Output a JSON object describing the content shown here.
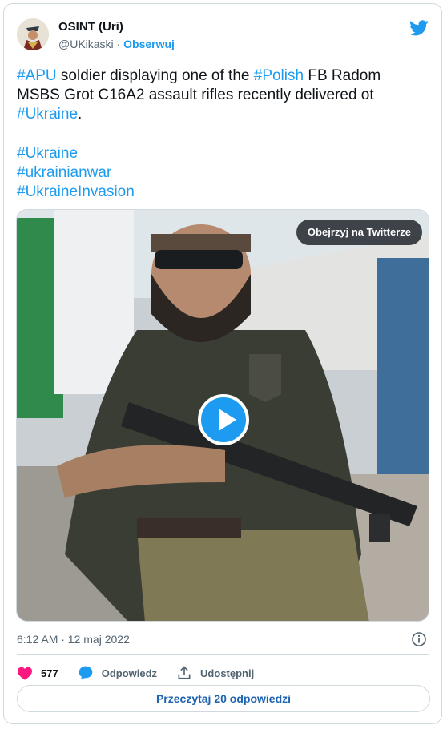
{
  "author": {
    "display_name": "OSINT (Uri)",
    "handle": "@UKikaski",
    "separator": "·",
    "follow_label": "Obserwuj"
  },
  "tweet": {
    "text_parts": {
      "t1": "#APU",
      "t2": " soldier displaying one of the ",
      "t3": "#Polish",
      "t4": " FB Radom MSBS Grot C16A2 assault rifles recently delivered ot ",
      "t5": "#Ukraine",
      "t6": "."
    },
    "hashtags": [
      "#Ukraine",
      "#ukrainianwar",
      "#UkraineInvasion"
    ]
  },
  "media": {
    "watch_label": "Obejrzyj na Twitterze"
  },
  "timestamp": "6:12 AM · 12 maj 2022",
  "actions": {
    "likes": "577",
    "reply_label": "Odpowiedz",
    "share_label": "Udostępnij"
  },
  "read_replies_label": "Przeczytaj 20 odpowiedzi",
  "colors": {
    "accent": "#1d9bf0",
    "like": "#f91880",
    "text": "#0f1419",
    "muted": "#536471"
  }
}
